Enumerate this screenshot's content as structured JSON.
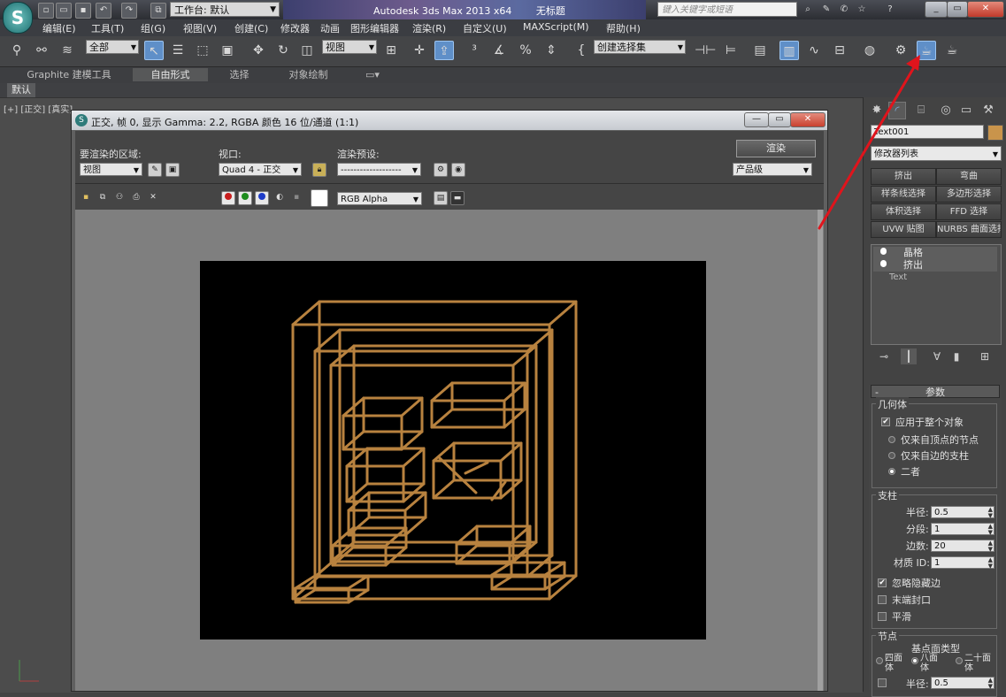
{
  "titlebar": {
    "workspace_prefix": "工作台:",
    "workspace_value": "默认",
    "app_title": "Autodesk 3ds Max  2013 x64",
    "doc_title": "无标题",
    "search_placeholder": "键入关键字或短语"
  },
  "menubar": {
    "items": [
      "编辑(E)",
      "工具(T)",
      "组(G)",
      "视图(V)",
      "创建(C)",
      "修改器",
      "动画",
      "图形编辑器",
      "渲染(R)",
      "自定义(U)",
      "MAXScript(M)",
      "帮助(H)"
    ]
  },
  "toolbar": {
    "selection_filter": "全部",
    "ref_coord": "视图",
    "named_selection": "创建选择集"
  },
  "ribbon": {
    "tabs": [
      "Graphite 建模工具",
      "自由形式",
      "选择",
      "对象绘制"
    ],
    "selected_tab": "自由形式",
    "sub_tab": "默认"
  },
  "viewport": {
    "label": "[+] [正交] [真实]"
  },
  "render_frame": {
    "title": "正交, 帧 0, 显示 Gamma: 2.2, RGBA 颜色 16 位/通道 (1:1)",
    "area_label": "要渲染的区域:",
    "area_value": "视图",
    "viewport_label": "视口:",
    "viewport_value": "Quad 4 - 正交",
    "preset_label": "渲染预设:",
    "preset_value": "-------------------",
    "render_button": "渲染",
    "quality_value": "产品级",
    "channel_value": "RGB Alpha",
    "wire_color": "#b8823f"
  },
  "command_panel": {
    "object_name": "Text001",
    "object_color": "#c9944b",
    "modifier_list": "修改器列表",
    "modifier_buttons": [
      "挤出",
      "弯曲",
      "样条线选择",
      "多边形选择",
      "体积选择",
      "FFD 选择",
      "UVW 贴图",
      "NURBS 曲面选择"
    ],
    "stack": [
      "晶格",
      "挤出",
      "Text"
    ],
    "params_title": "参数",
    "geometry_group": "几何体",
    "apply_all": "应用于整个对象",
    "opt_vertex": "仅来自顶点的节点",
    "opt_edge": "仅来自边的支柱",
    "opt_both": "二者",
    "struts_group": "支柱",
    "radius_label": "半径:",
    "radius_value": "0.5",
    "segments_label": "分段:",
    "segments_value": "1",
    "sides_label": "边数:",
    "sides_value": "20",
    "matid_label": "材质 ID:",
    "matid_value": "1",
    "ignore_hidden": "忽略隐藏边",
    "end_caps": "末端封口",
    "smooth": "平滑",
    "joints_group": "节点",
    "base_type_label": "基点面类型",
    "tetra": "四面体",
    "octa": "八面体",
    "icosa": "二十面体",
    "joint_radius_label": "半径:",
    "joint_radius_value": "0.5"
  },
  "annotation": {
    "arrow_color": "#e0141c"
  }
}
